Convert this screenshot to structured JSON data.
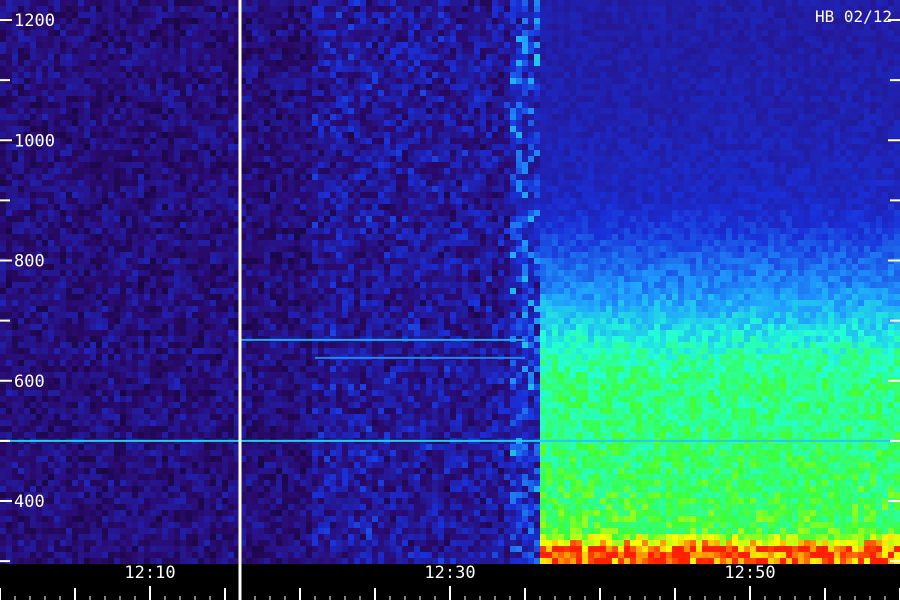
{
  "chart_data": {
    "type": "heatmap",
    "title": "HB 02/12",
    "xlabel": "",
    "ylabel": "",
    "x_unit": "time",
    "x_range": [
      "12:00",
      "13:00"
    ],
    "x_tick_labels": [
      {
        "value": "12:10",
        "label": "12:10"
      },
      {
        "value": "12:30",
        "label": "12:30"
      },
      {
        "value": "12:50",
        "label": "12:50"
      }
    ],
    "y_range": [
      300,
      1250
    ],
    "y_tick_labels": [
      {
        "value": 400,
        "label": "400"
      },
      {
        "value": 600,
        "label": "600"
      },
      {
        "value": 800,
        "label": "800"
      },
      {
        "value": 1000,
        "label": "1000"
      },
      {
        "value": 1200,
        "label": "1200"
      }
    ],
    "y_minor_ticks": [
      300,
      500,
      700,
      900,
      1100
    ],
    "vertical_marker_time": "12:16",
    "colormap": [
      "#000000",
      "#2a0a6e",
      "#1a2fd8",
      "#1f9aff",
      "#22ffd6",
      "#3cff3c",
      "#ffff00",
      "#ff2000"
    ],
    "emission_lines": [
      {
        "frequency": 500,
        "start": "12:00",
        "end": "13:00",
        "intensity": 0.35
      },
      {
        "frequency": 668,
        "start": "12:16",
        "end": "12:35",
        "intensity": 0.3
      },
      {
        "frequency": 638,
        "start": "12:21",
        "end": "12:35",
        "intensity": 0.25
      }
    ],
    "activity": [
      {
        "start": "12:00",
        "end": "12:05",
        "level": 0.12
      },
      {
        "start": "12:05",
        "end": "12:21",
        "level": 0.12
      },
      {
        "start": "12:21",
        "end": "12:34",
        "level": 0.22
      },
      {
        "start": "12:34",
        "end": "12:36",
        "level": 0.45
      },
      {
        "start": "12:36",
        "end": "13:00",
        "level": 1.0
      }
    ],
    "spectrum_profile": [
      {
        "frequency": 320,
        "level": 0.97
      },
      {
        "frequency": 350,
        "level": 0.72
      },
      {
        "frequency": 400,
        "level": 0.7
      },
      {
        "frequency": 450,
        "level": 0.68
      },
      {
        "frequency": 500,
        "level": 0.67
      },
      {
        "frequency": 550,
        "level": 0.66
      },
      {
        "frequency": 600,
        "level": 0.66
      },
      {
        "frequency": 650,
        "level": 0.6
      },
      {
        "frequency": 700,
        "level": 0.5
      },
      {
        "frequency": 750,
        "level": 0.42
      },
      {
        "frequency": 800,
        "level": 0.36
      },
      {
        "frequency": 850,
        "level": 0.3
      },
      {
        "frequency": 900,
        "level": 0.26
      },
      {
        "frequency": 950,
        "level": 0.25
      },
      {
        "frequency": 1000,
        "level": 0.24
      },
      {
        "frequency": 1050,
        "level": 0.23
      },
      {
        "frequency": 1100,
        "level": 0.23
      },
      {
        "frequency": 1150,
        "level": 0.22
      },
      {
        "frequency": 1200,
        "level": 0.22
      },
      {
        "frequency": 1250,
        "level": 0.22
      }
    ],
    "legend": "none",
    "grid": false
  }
}
